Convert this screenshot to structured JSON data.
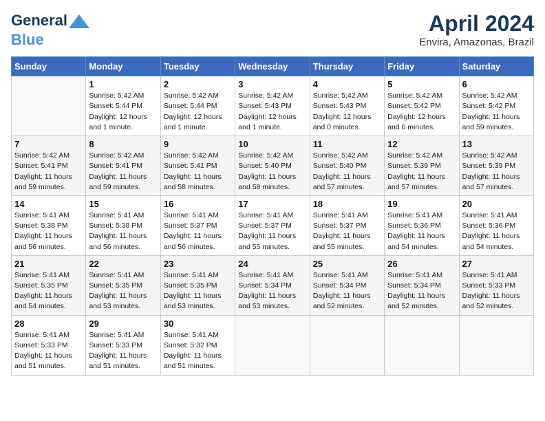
{
  "header": {
    "logo_line1": "General",
    "logo_line2": "Blue",
    "title": "April 2024",
    "subtitle": "Envira, Amazonas, Brazil"
  },
  "calendar": {
    "days_of_week": [
      "Sunday",
      "Monday",
      "Tuesday",
      "Wednesday",
      "Thursday",
      "Friday",
      "Saturday"
    ],
    "weeks": [
      [
        {
          "num": "",
          "info": ""
        },
        {
          "num": "1",
          "info": "Sunrise: 5:42 AM\nSunset: 5:44 PM\nDaylight: 12 hours\nand 1 minute."
        },
        {
          "num": "2",
          "info": "Sunrise: 5:42 AM\nSunset: 5:44 PM\nDaylight: 12 hours\nand 1 minute."
        },
        {
          "num": "3",
          "info": "Sunrise: 5:42 AM\nSunset: 5:43 PM\nDaylight: 12 hours\nand 1 minute."
        },
        {
          "num": "4",
          "info": "Sunrise: 5:42 AM\nSunset: 5:43 PM\nDaylight: 12 hours\nand 0 minutes."
        },
        {
          "num": "5",
          "info": "Sunrise: 5:42 AM\nSunset: 5:42 PM\nDaylight: 12 hours\nand 0 minutes."
        },
        {
          "num": "6",
          "info": "Sunrise: 5:42 AM\nSunset: 5:42 PM\nDaylight: 11 hours\nand 59 minutes."
        }
      ],
      [
        {
          "num": "7",
          "info": "Sunrise: 5:42 AM\nSunset: 5:41 PM\nDaylight: 11 hours\nand 59 minutes."
        },
        {
          "num": "8",
          "info": "Sunrise: 5:42 AM\nSunset: 5:41 PM\nDaylight: 11 hours\nand 59 minutes."
        },
        {
          "num": "9",
          "info": "Sunrise: 5:42 AM\nSunset: 5:41 PM\nDaylight: 11 hours\nand 58 minutes."
        },
        {
          "num": "10",
          "info": "Sunrise: 5:42 AM\nSunset: 5:40 PM\nDaylight: 11 hours\nand 58 minutes."
        },
        {
          "num": "11",
          "info": "Sunrise: 5:42 AM\nSunset: 5:40 PM\nDaylight: 11 hours\nand 57 minutes."
        },
        {
          "num": "12",
          "info": "Sunrise: 5:42 AM\nSunset: 5:39 PM\nDaylight: 11 hours\nand 57 minutes."
        },
        {
          "num": "13",
          "info": "Sunrise: 5:42 AM\nSunset: 5:39 PM\nDaylight: 11 hours\nand 57 minutes."
        }
      ],
      [
        {
          "num": "14",
          "info": "Sunrise: 5:41 AM\nSunset: 5:38 PM\nDaylight: 11 hours\nand 56 minutes."
        },
        {
          "num": "15",
          "info": "Sunrise: 5:41 AM\nSunset: 5:38 PM\nDaylight: 11 hours\nand 56 minutes."
        },
        {
          "num": "16",
          "info": "Sunrise: 5:41 AM\nSunset: 5:37 PM\nDaylight: 11 hours\nand 56 minutes."
        },
        {
          "num": "17",
          "info": "Sunrise: 5:41 AM\nSunset: 5:37 PM\nDaylight: 11 hours\nand 55 minutes."
        },
        {
          "num": "18",
          "info": "Sunrise: 5:41 AM\nSunset: 5:37 PM\nDaylight: 11 hours\nand 55 minutes."
        },
        {
          "num": "19",
          "info": "Sunrise: 5:41 AM\nSunset: 5:36 PM\nDaylight: 11 hours\nand 54 minutes."
        },
        {
          "num": "20",
          "info": "Sunrise: 5:41 AM\nSunset: 5:36 PM\nDaylight: 11 hours\nand 54 minutes."
        }
      ],
      [
        {
          "num": "21",
          "info": "Sunrise: 5:41 AM\nSunset: 5:35 PM\nDaylight: 11 hours\nand 54 minutes."
        },
        {
          "num": "22",
          "info": "Sunrise: 5:41 AM\nSunset: 5:35 PM\nDaylight: 11 hours\nand 53 minutes."
        },
        {
          "num": "23",
          "info": "Sunrise: 5:41 AM\nSunset: 5:35 PM\nDaylight: 11 hours\nand 53 minutes."
        },
        {
          "num": "24",
          "info": "Sunrise: 5:41 AM\nSunset: 5:34 PM\nDaylight: 11 hours\nand 53 minutes."
        },
        {
          "num": "25",
          "info": "Sunrise: 5:41 AM\nSunset: 5:34 PM\nDaylight: 11 hours\nand 52 minutes."
        },
        {
          "num": "26",
          "info": "Sunrise: 5:41 AM\nSunset: 5:34 PM\nDaylight: 11 hours\nand 52 minutes."
        },
        {
          "num": "27",
          "info": "Sunrise: 5:41 AM\nSunset: 5:33 PM\nDaylight: 11 hours\nand 52 minutes."
        }
      ],
      [
        {
          "num": "28",
          "info": "Sunrise: 5:41 AM\nSunset: 5:33 PM\nDaylight: 11 hours\nand 51 minutes."
        },
        {
          "num": "29",
          "info": "Sunrise: 5:41 AM\nSunset: 5:33 PM\nDaylight: 11 hours\nand 51 minutes."
        },
        {
          "num": "30",
          "info": "Sunrise: 5:41 AM\nSunset: 5:32 PM\nDaylight: 11 hours\nand 51 minutes."
        },
        {
          "num": "",
          "info": ""
        },
        {
          "num": "",
          "info": ""
        },
        {
          "num": "",
          "info": ""
        },
        {
          "num": "",
          "info": ""
        }
      ]
    ]
  }
}
